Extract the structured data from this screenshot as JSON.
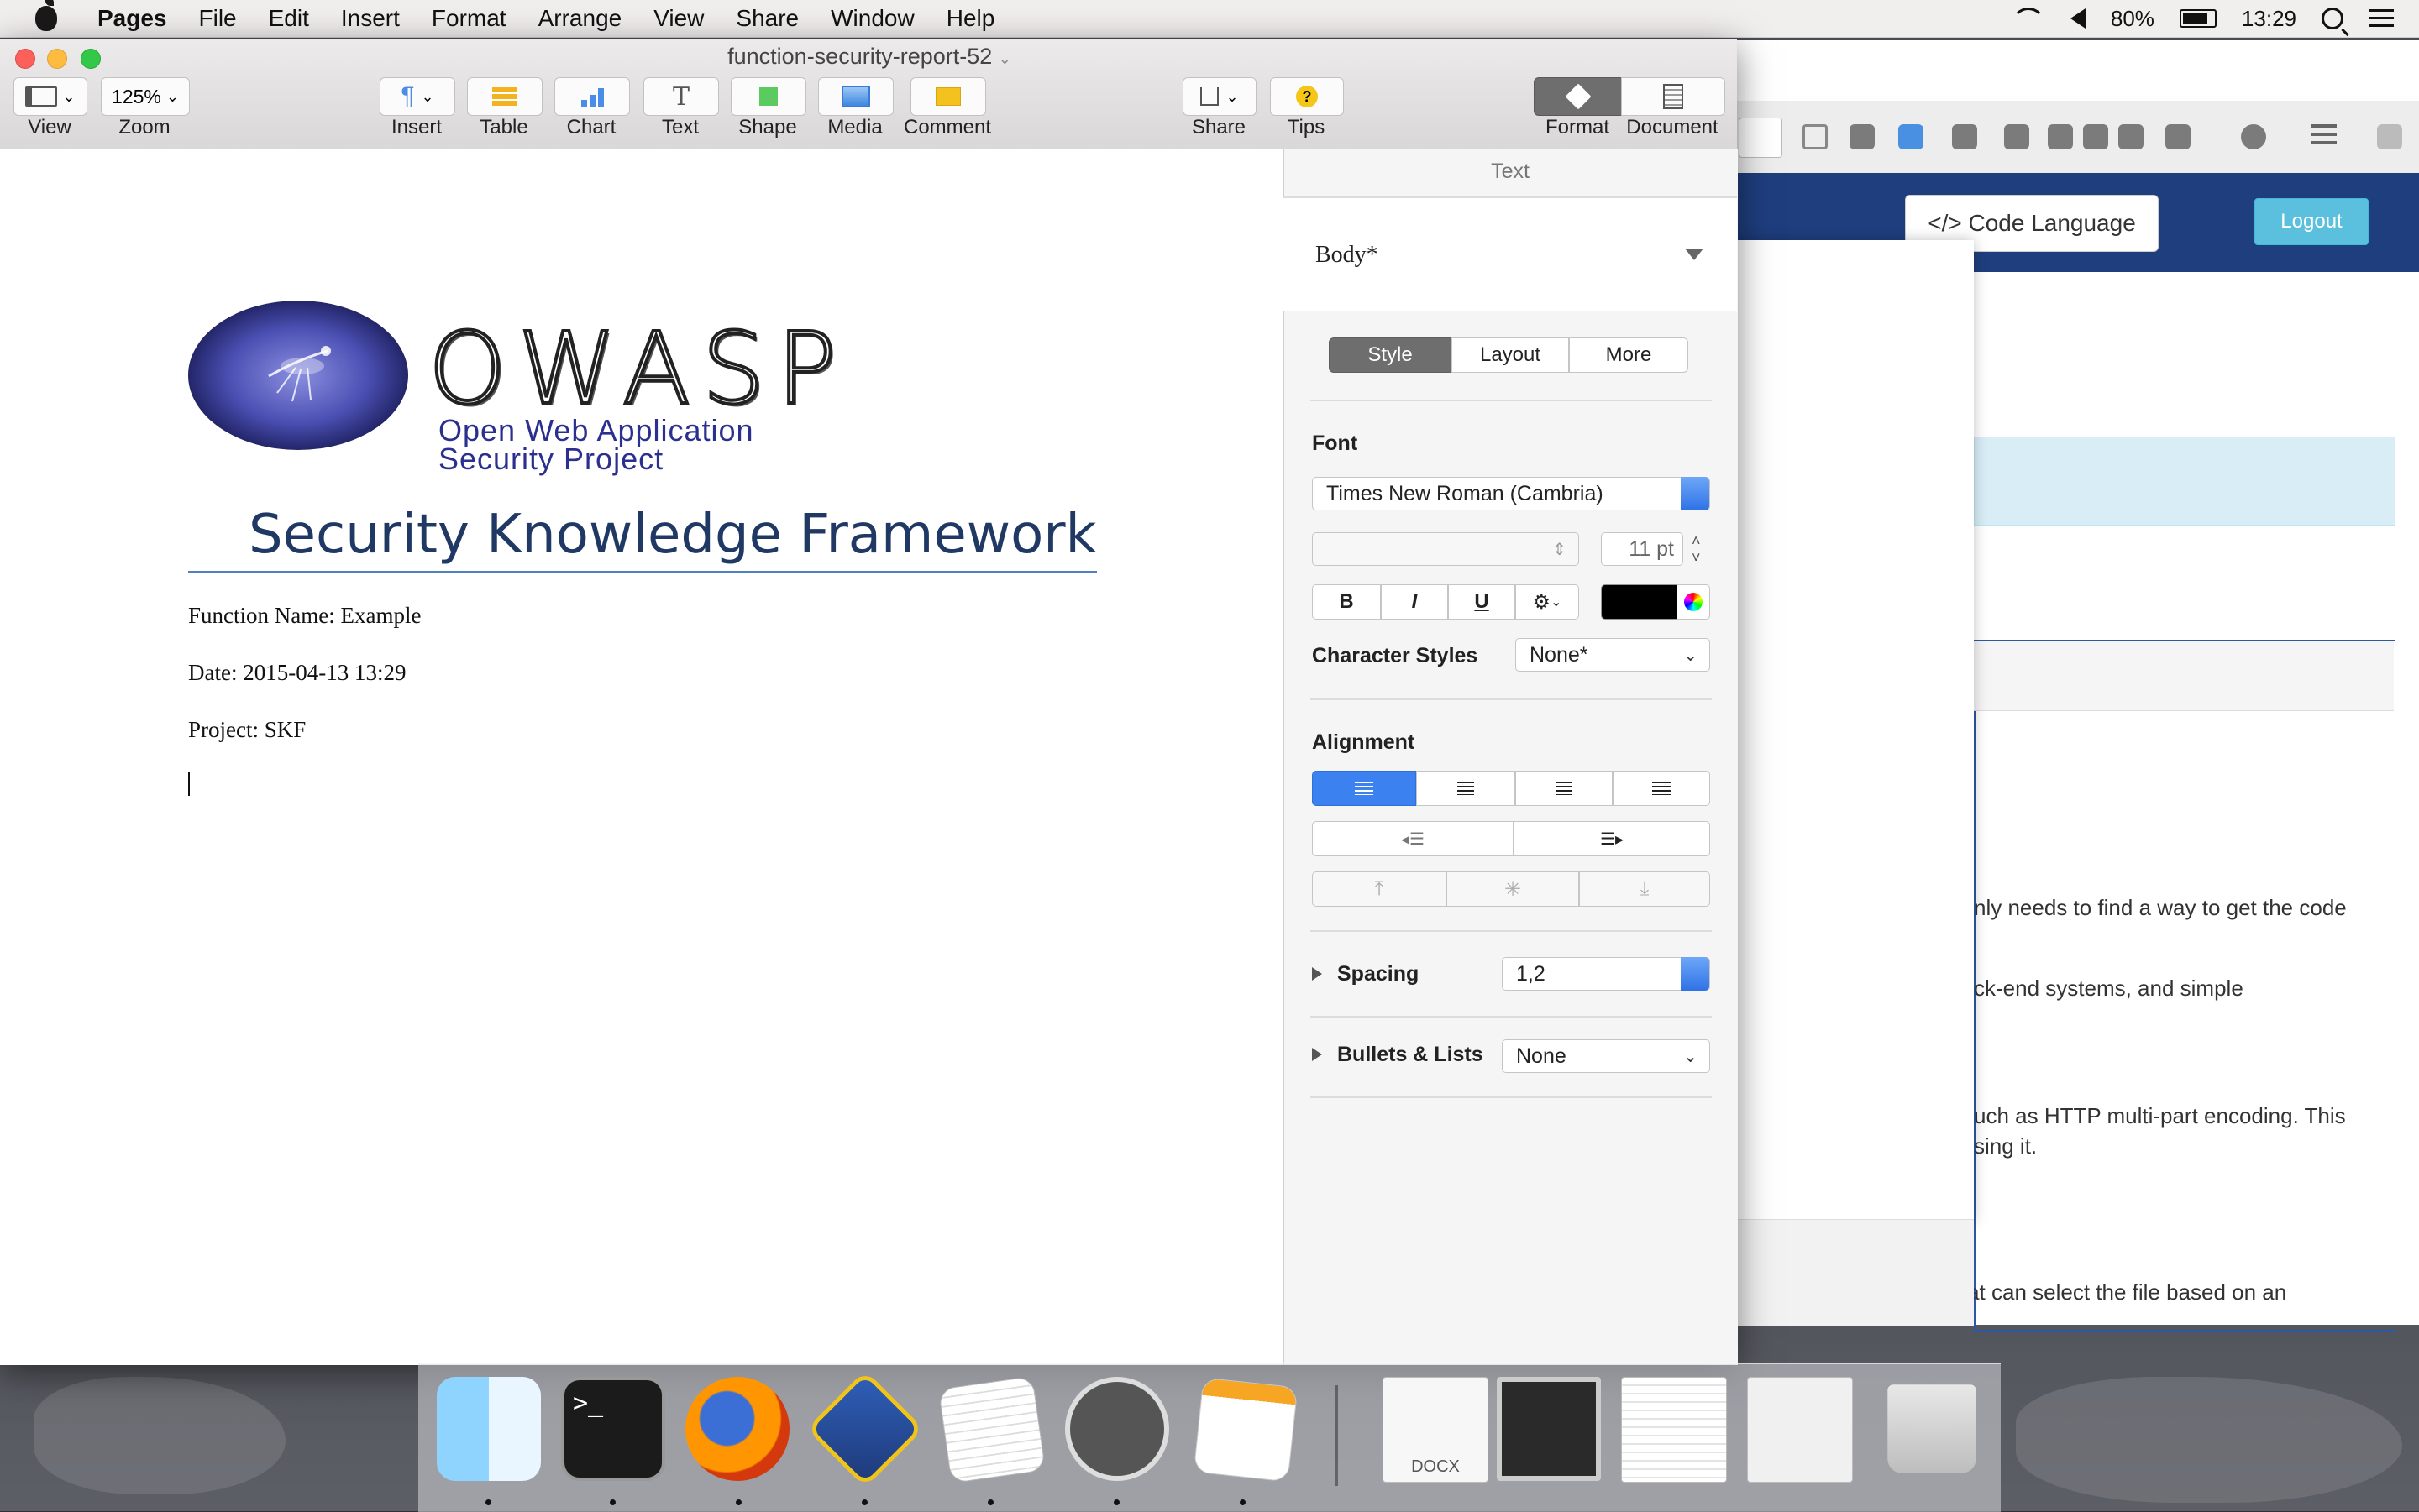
{
  "menubar": {
    "app_name": "Pages",
    "items": [
      "File",
      "Edit",
      "Insert",
      "Format",
      "Arrange",
      "View",
      "Share",
      "Window",
      "Help"
    ],
    "battery_percent": "80%",
    "battery_level": 0.8,
    "clock": "13:29",
    "icons": [
      "apple-icon",
      "wifi-icon",
      "volume-icon",
      "battery-icon",
      "spotlight-icon",
      "notification-list-icon"
    ]
  },
  "window": {
    "title": "function-security-report-52",
    "toolbar": {
      "view": "View",
      "zoom_value": "125%",
      "zoom": "Zoom",
      "insert": "Insert",
      "table": "Table",
      "chart": "Chart",
      "text": "Text",
      "shape": "Shape",
      "media": "Media",
      "comment": "Comment",
      "share": "Share",
      "tips": "Tips",
      "format": "Format",
      "document": "Document"
    }
  },
  "document": {
    "logo_word": "OWASP",
    "logo_sub1": "Open Web Application",
    "logo_sub2": "Security Project",
    "title": "Security Knowledge Framework",
    "function_name": "Function Name: Example",
    "date": "Date: 2015-04-13 13:29",
    "project": "Project: SKF"
  },
  "inspector": {
    "header": "Text",
    "paragraph_style": "Body*",
    "tabs": [
      "Style",
      "Layout",
      "More"
    ],
    "font_label": "Font",
    "font_family": "Times New Roman (Cambria)",
    "font_size": "11 pt",
    "bold": "B",
    "italic": "I",
    "underline": "U",
    "text_color": "#000000",
    "char_styles_label": "Character Styles",
    "char_styles_value": "None*",
    "alignment_label": "Alignment",
    "spacing_label": "Spacing",
    "spacing_value": "1,2",
    "bullets_label": "Bullets & Lists",
    "bullets_value": "None"
  },
  "background_browser": {
    "code_language": "</> Code Language",
    "logout": "Logout",
    "snippets": [
      "nly needs to find a way to get the code",
      "ck-end systems, and simple",
      "uch as HTTP multi-part encoding. This",
      "sing it.",
      "a file handler function that can select the file based on an"
    ]
  },
  "dock": {
    "apps": [
      "finder-icon",
      "terminal-icon",
      "firefox-icon",
      "textwrangler-icon",
      "textedit-icon",
      "mamp-icon",
      "pages-icon"
    ],
    "stack_label": "DOCX"
  },
  "colors": {
    "accent": "#2f72e6",
    "owasp_blue": "#2b2f8e",
    "title_blue": "#1f3864",
    "web_header": "#1f3e7e",
    "logout": "#5bc0de"
  }
}
